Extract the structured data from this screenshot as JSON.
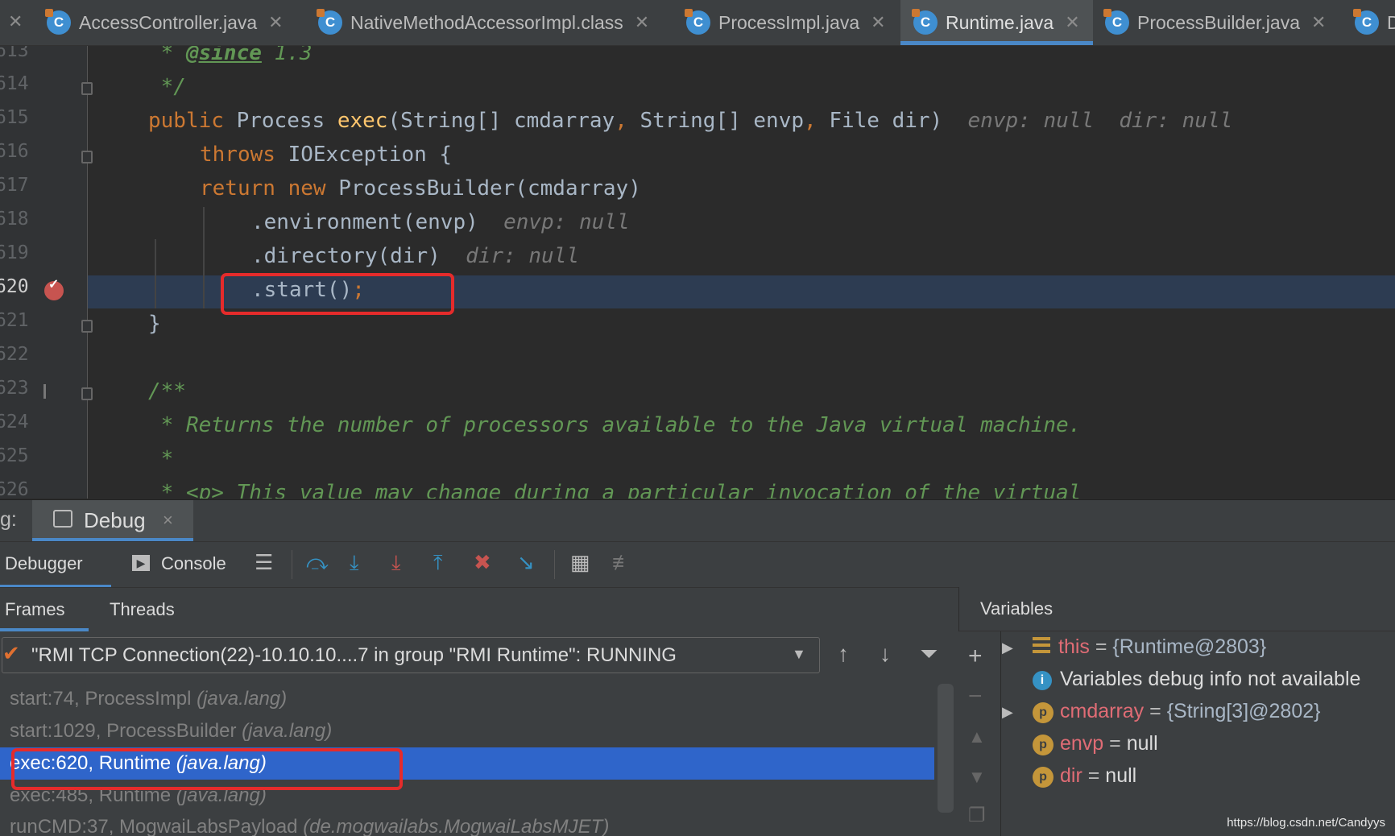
{
  "tabs": [
    {
      "label": "AccessController.java",
      "active": false
    },
    {
      "label": "NativeMethodAccessorImpl.class",
      "active": false
    },
    {
      "label": "ProcessImpl.java",
      "active": false
    },
    {
      "label": "Runtime.java",
      "active": true
    },
    {
      "label": "ProcessBuilder.java",
      "active": false
    },
    {
      "label": "D",
      "active": false
    }
  ],
  "editor": {
    "line_numbers": [
      "613",
      "614",
      "615",
      "616",
      "617",
      "618",
      "619",
      "620",
      "621",
      "622",
      "623",
      "624",
      "625",
      "626"
    ],
    "current_line": "620",
    "lines": {
      "l13": [
        " * ",
        "@since",
        " 1.3"
      ],
      "l14": " */",
      "l15": [
        "public ",
        "Process ",
        "exec",
        "(String[] cmdarray",
        ", ",
        "String[] envp",
        ", ",
        "File dir)",
        "  envp: null  dir: null"
      ],
      "l16": [
        "throws ",
        "IOException {"
      ],
      "l17": [
        "return new ",
        "ProcessBuilder(cmdarray)"
      ],
      "l18": [
        ".environment(envp)",
        "  envp: null"
      ],
      "l19": [
        ".directory(dir)",
        "  dir: null"
      ],
      "l20": [
        ".start()",
        ";"
      ],
      "l21": "}",
      "l23": "/**",
      "l24": " * Returns the number of processors available to the Java virtual machine.",
      "l25": " *",
      "l26": " * <p> This value may change during a particular invocation of the virtual"
    }
  },
  "tool_window": {
    "prefix": "g:",
    "title": "Debug",
    "close": "×"
  },
  "toolbar": {
    "debugger_tab": "Debugger",
    "console_tab": "Console"
  },
  "subtabs": {
    "frames": "Frames",
    "threads": "Threads",
    "variables": "Variables"
  },
  "thread_selector": "\"RMI TCP Connection(22)-10.10.10....7 in group \"RMI Runtime\": RUNNING",
  "frames": [
    {
      "method": "start:74, ProcessImpl ",
      "pkg": "(java.lang)",
      "selected": false
    },
    {
      "method": "start:1029, ProcessBuilder ",
      "pkg": "(java.lang)",
      "selected": false
    },
    {
      "method": "exec:620, Runtime ",
      "pkg": "(java.lang)",
      "selected": true
    },
    {
      "method": "exec:485, Runtime ",
      "pkg": "(java.lang)",
      "selected": false
    },
    {
      "method": "runCMD:37, MogwaiLabsPayload ",
      "pkg": "(de.mogwailabs.MogwaiLabsMJET)",
      "selected": false
    }
  ],
  "variables": [
    {
      "name": "this",
      "value": "{Runtime@2803}",
      "expandable": true,
      "icon": "field-list-icon"
    },
    {
      "name": "",
      "value": "Variables debug info not available",
      "expandable": false,
      "icon": "info-icon"
    },
    {
      "name": "cmdarray",
      "value": "{String[3]@2802}",
      "expandable": true,
      "icon": "p"
    },
    {
      "name": "envp",
      "value": "null",
      "expandable": false,
      "icon": "p"
    },
    {
      "name": "dir",
      "value": "null",
      "expandable": false,
      "icon": "p"
    }
  ],
  "watermark": "https://blog.csdn.net/Candyys",
  "colors": {
    "background": "#2b2b2b",
    "keyword": "#cc7832",
    "method": "#ffc66d",
    "comment": "#629755",
    "selection": "#2f65ca",
    "highlight_box": "#e52b2b"
  }
}
